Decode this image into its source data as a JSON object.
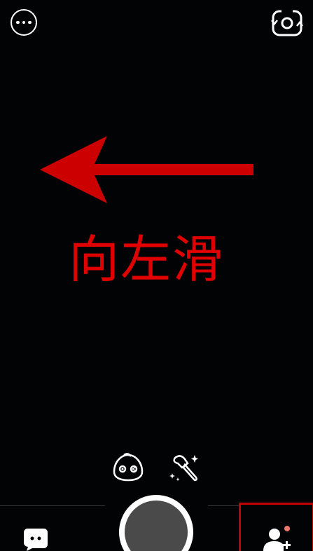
{
  "overlay": {
    "hint_text": "向左滑",
    "hint_color": "#e00000",
    "arrow_direction": "left",
    "highlight_color": "#c40000"
  },
  "top_bar": {
    "more_icon": "more-horizontal-icon",
    "flip_icon": "camera-flip-icon"
  },
  "tools": {
    "face_icon": "face-lens-icon",
    "beauty_icon": "beauty-brush-icon"
  },
  "bottom_bar": {
    "chat_icon": "chat-bubble-icon",
    "shutter_icon": "shutter-button",
    "add_friend_icon": "add-friend-icon",
    "notification_dot_color": "#f0766e"
  }
}
